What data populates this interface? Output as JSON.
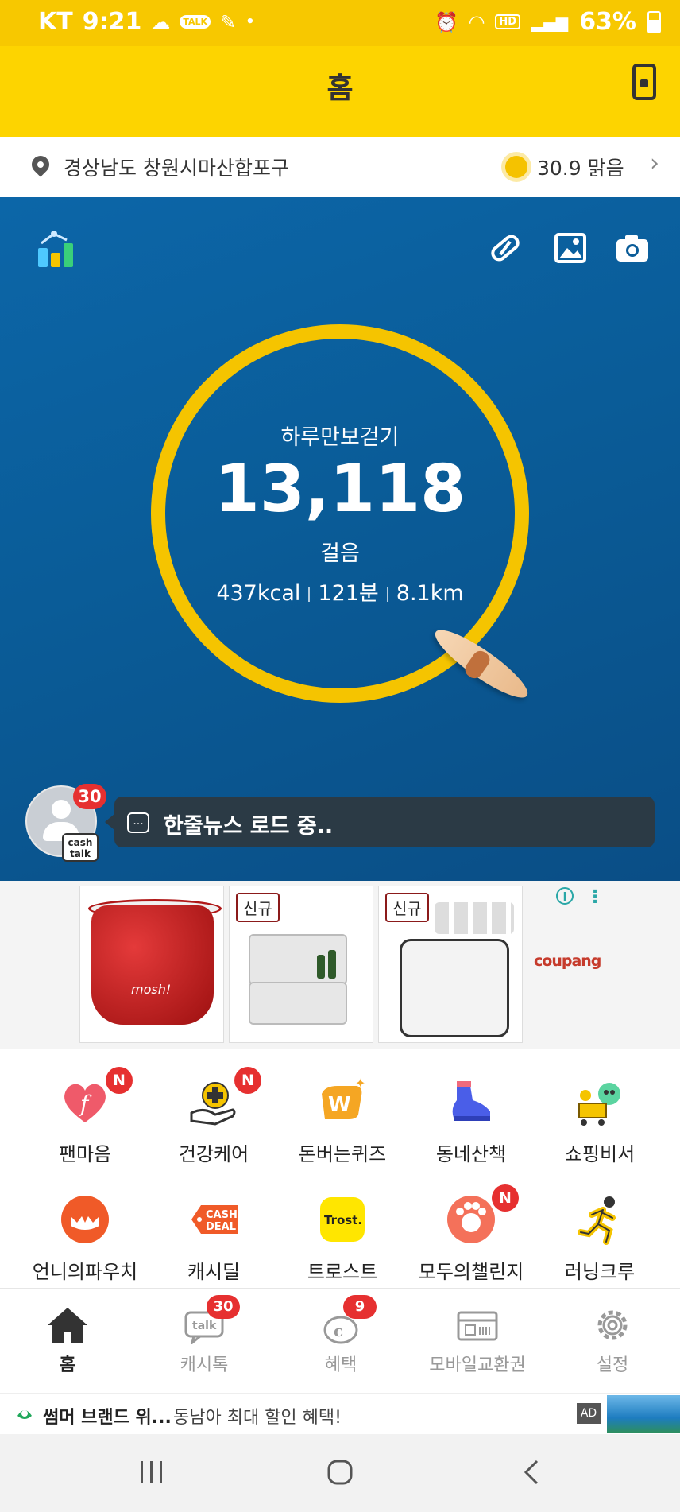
{
  "status_bar": {
    "carrier": "KT",
    "time": "9:21",
    "talk_icon_text": "TALK",
    "hd_text": "HD",
    "battery": "63%"
  },
  "header": {
    "title": "홈"
  },
  "location": {
    "address": "경상남도 창원시마산합포구",
    "weather": "30.9 맑음"
  },
  "steps": {
    "label": "하루만보걷기",
    "count": "13,118",
    "unit": "걸음",
    "kcal": "437kcal",
    "minutes": "121분",
    "distance": "8.1km"
  },
  "news": {
    "badge": "30",
    "cashtalk_tag_line1": "cash",
    "cashtalk_tag_line2": "talk",
    "icon_text": "...",
    "text": "한줄뉴스 로드 중.."
  },
  "ad_products": {
    "items": [
      {
        "badge": "",
        "brand_text": "mosh!"
      },
      {
        "badge": "신규"
      },
      {
        "badge": "신규"
      }
    ],
    "advertiser": "coupang",
    "info_icon": "i"
  },
  "menu": {
    "items": [
      {
        "label": "팬마음",
        "badge": "N",
        "icon": "heart-f-icon"
      },
      {
        "label": "건강케어",
        "badge": "N",
        "icon": "health-care-icon"
      },
      {
        "label": "돈버는퀴즈",
        "badge": "",
        "icon": "quiz-icon"
      },
      {
        "label": "동네산책",
        "badge": "",
        "icon": "sneaker-icon"
      },
      {
        "label": "쇼핑비서",
        "badge": "",
        "icon": "shopping-cart-icon"
      },
      {
        "label": "언니의파우치",
        "badge": "",
        "icon": "pouch-icon"
      },
      {
        "label": "캐시딜",
        "badge": "",
        "icon": "cash-deal-icon",
        "icon_text_1": "CASH",
        "icon_text_2": "DEAL"
      },
      {
        "label": "트로스트",
        "badge": "",
        "icon": "trost-icon",
        "icon_text": "Trost."
      },
      {
        "label": "모두의챌린지",
        "badge": "N",
        "icon": "challenge-icon"
      },
      {
        "label": "러닝크루",
        "badge": "",
        "icon": "runner-icon"
      }
    ]
  },
  "bottom_nav": {
    "items": [
      {
        "label": "홈",
        "active": true,
        "badge": ""
      },
      {
        "label": "캐시톡",
        "badge": "30"
      },
      {
        "label": "혜택",
        "badge": "9"
      },
      {
        "label": "모바일교환권",
        "badge": ""
      },
      {
        "label": "설정",
        "badge": ""
      }
    ]
  },
  "banner": {
    "title": "썸머 브랜드 위...",
    "description": "동남아 최대 할인 혜택!",
    "ad_label": "AD"
  },
  "colors": {
    "brand_yellow": "#fdd400",
    "ring_yellow": "#f5c400",
    "badge_red": "#e63030",
    "ocean": "#0a5c98"
  }
}
